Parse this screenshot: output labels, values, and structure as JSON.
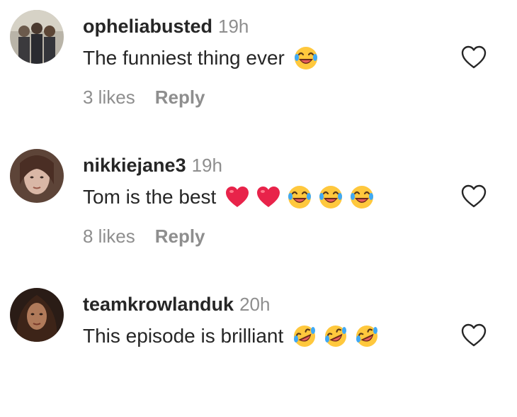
{
  "comments": [
    {
      "username": "opheliabusted",
      "time": "19h",
      "text": "The funniest thing ever",
      "emojis": [
        "laugh-emoji"
      ],
      "likes": "3 likes",
      "reply": "Reply"
    },
    {
      "username": "nikkiejane3",
      "time": "19h",
      "text": "Tom is the best",
      "emojis": [
        "red-heart-emoji",
        "red-heart-emoji",
        "laugh-emoji",
        "laugh-emoji",
        "laugh-emoji"
      ],
      "likes": "8 likes",
      "reply": "Reply"
    },
    {
      "username": "teamkrowlanduk",
      "time": "20h",
      "text": "This episode is brilliant",
      "emojis": [
        "rofl-emoji",
        "rofl-emoji",
        "rofl-emoji"
      ]
    }
  ],
  "colors": {
    "text": "#262626",
    "secondary": "#8e8e8e",
    "heart_emoji": "#e8234a",
    "emoji_face": "#ffc83d"
  }
}
